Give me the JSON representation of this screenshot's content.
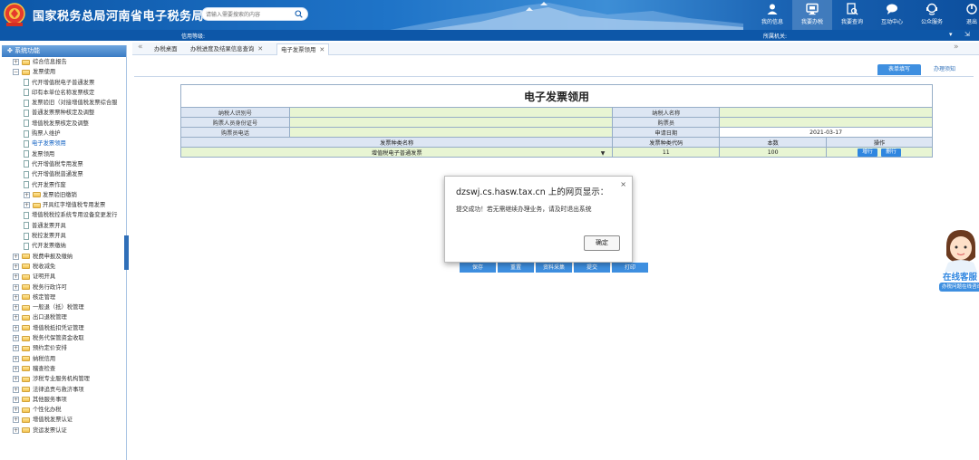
{
  "header": {
    "title": "国家税务总局河南省电子税务局",
    "search_placeholder": "请输入需要搜索的内容",
    "nav": [
      {
        "label": "我的信息",
        "icon": "user-icon"
      },
      {
        "label": "我要办税",
        "icon": "monitor-icon",
        "active": true
      },
      {
        "label": "我要查询",
        "icon": "search-doc-icon"
      },
      {
        "label": "互动中心",
        "icon": "chat-icon"
      },
      {
        "label": "公众服务",
        "icon": "service-icon"
      },
      {
        "label": "退出",
        "icon": "exit-icon"
      }
    ]
  },
  "subbar": {
    "credit": "信用等级:",
    "authority": "所属机关:"
  },
  "sidebar": {
    "title": "系统功能",
    "items": [
      {
        "label": "综合信息报告",
        "level": 0
      },
      {
        "label": "发票使用",
        "level": 0,
        "expanded": true
      },
      {
        "label": "代开增值税电子普通发票",
        "level": 1
      },
      {
        "label": "印有本单位名称发票核定",
        "level": 1
      },
      {
        "label": "发票验旧（对接增值税发票综合服",
        "level": 1
      },
      {
        "label": "普通发票票种核定及调整",
        "level": 1
      },
      {
        "label": "增值税发票核定及调整",
        "level": 1
      },
      {
        "label": "购票人维护",
        "level": 1
      },
      {
        "label": "电子发票领用",
        "level": 1,
        "selected": true
      },
      {
        "label": "发票领用",
        "level": 1
      },
      {
        "label": "代开增值税专用发票",
        "level": 1
      },
      {
        "label": "代开增值税普通发票",
        "level": 1
      },
      {
        "label": "代开发票作废",
        "level": 1
      },
      {
        "label": "发票验旧缴销",
        "level": 2
      },
      {
        "label": "开具红字增值税专用发票",
        "level": 2
      },
      {
        "label": "增值税税控系统专用设备变更发行",
        "level": 1
      },
      {
        "label": "普通发票开具",
        "level": 1
      },
      {
        "label": "税控发票开具",
        "level": 1
      },
      {
        "label": "代开发票缴纳",
        "level": 1
      },
      {
        "label": "税费申报及缴纳",
        "level": 0
      },
      {
        "label": "税收减免",
        "level": 0
      },
      {
        "label": "证明开具",
        "level": 0
      },
      {
        "label": "税务行政许可",
        "level": 0
      },
      {
        "label": "核定管理",
        "level": 0
      },
      {
        "label": "一般退（抵）税管理",
        "level": 0
      },
      {
        "label": "出口退税管理",
        "level": 0
      },
      {
        "label": "增值税抵扣凭证管理",
        "level": 0
      },
      {
        "label": "税务代保管资金收取",
        "level": 0
      },
      {
        "label": "预约定价安排",
        "level": 0
      },
      {
        "label": "纳税信用",
        "level": 0
      },
      {
        "label": "稽查检查",
        "level": 0
      },
      {
        "label": "涉税专业服务机构管理",
        "level": 0
      },
      {
        "label": "法律追责与救济事项",
        "level": 0
      },
      {
        "label": "其他服务事项",
        "level": 0
      },
      {
        "label": "个性化办税",
        "level": 0
      },
      {
        "label": "增值税发票认证",
        "level": 0
      },
      {
        "label": "货运发票认证",
        "level": 0
      }
    ]
  },
  "tabs": [
    {
      "label": "办税桌面",
      "closable": false
    },
    {
      "label": "办税进度及结果信息查询",
      "closable": true
    },
    {
      "label": "电子发票领用",
      "closable": true,
      "active": true
    }
  ],
  "right_tabs": {
    "active": "表单填写",
    "other": "办理须知"
  },
  "form": {
    "title": "电子发票领用",
    "taxpayer_id_label": "纳税人识别号",
    "taxpayer_id_value": "",
    "taxpayer_name_label": "纳税人名称",
    "taxpayer_name_value": "",
    "buyer_id_label": "购票人员身份证号",
    "buyer_id_value": "",
    "buyer_label": "购票员",
    "buyer_value": "",
    "buyer_phone_label": "购票员电话",
    "buyer_phone_value": "",
    "apply_date_label": "申请日期",
    "apply_date_value": "2021-03-17",
    "col_type_name": "发票种类名称",
    "col_type_code": "发票种类代码",
    "col_count": "本数",
    "col_ops": "操作",
    "row": {
      "type_name": "增值税电子普通发票",
      "type_code": "11",
      "count": "100",
      "add_label": "增行",
      "del_label": "删行"
    }
  },
  "buttons": [
    "保存",
    "重置",
    "资料采集",
    "提交",
    "打印"
  ],
  "dialog": {
    "title": "dzswj.cs.hasw.tax.cn 上的网页显示：",
    "message": "提交成功！若无需继续办理业务，请及时退出系统",
    "ok_label": "确定"
  },
  "customer_service": {
    "label": "在线客服",
    "sub": "办税问题在线咨询"
  }
}
